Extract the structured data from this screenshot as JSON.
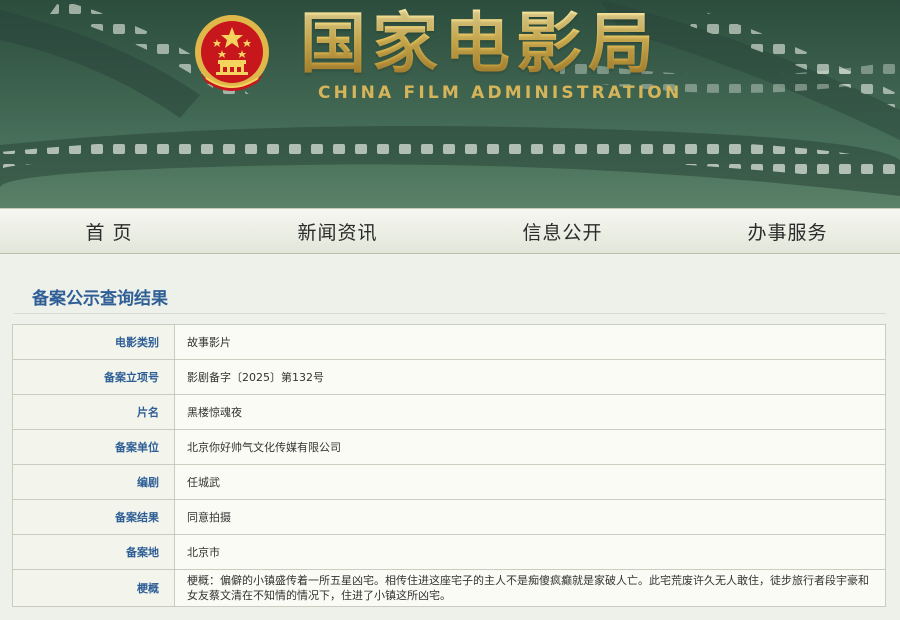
{
  "header": {
    "title_cn": "国家电影局",
    "title_en": "CHINA FILM ADMINISTRATION",
    "colors": {
      "banner_green": "#3a5e4b",
      "gold": "#d6b55a",
      "emblem_red": "#c8161d"
    }
  },
  "nav": {
    "items": [
      {
        "label": "首页"
      },
      {
        "label": "新闻资讯"
      },
      {
        "label": "信息公开"
      },
      {
        "label": "办事服务"
      }
    ]
  },
  "main": {
    "title": "备案公示查询结果",
    "rows": [
      {
        "label": "电影类别",
        "value": "故事影片"
      },
      {
        "label": "备案立项号",
        "value": "影剧备字〔2025〕第132号"
      },
      {
        "label": "片名",
        "value": "黑楼惊魂夜"
      },
      {
        "label": "备案单位",
        "value": "北京你好帅气文化传媒有限公司"
      },
      {
        "label": "编剧",
        "value": "任城武"
      },
      {
        "label": "备案结果",
        "value": "同意拍摄"
      },
      {
        "label": "备案地",
        "value": "北京市"
      },
      {
        "label": "梗概",
        "value": "梗概：偏僻的小镇盛传着一所五星凶宅。相传住进这座宅子的主人不是痴傻疯癫就是家破人亡。此宅荒废许久无人敢住，徒步旅行者段宇豪和女友蔡文清在不知情的情况下，住进了小镇这所凶宅。"
      }
    ]
  }
}
